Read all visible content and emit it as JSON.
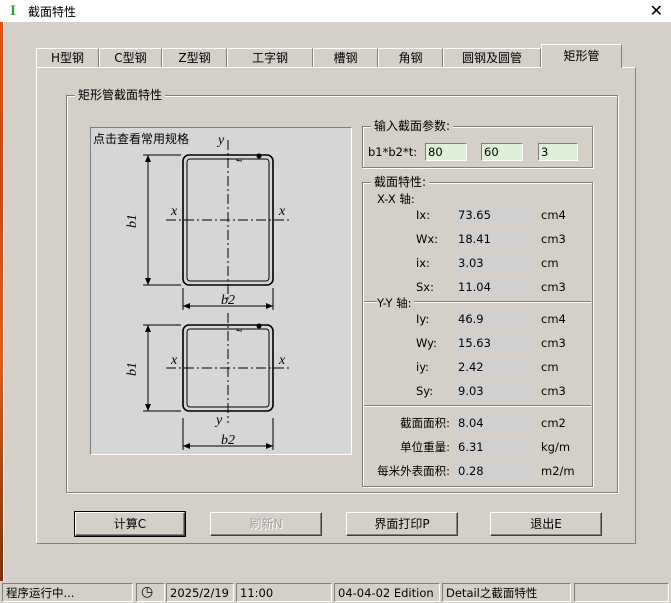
{
  "window": {
    "title": "截面特性",
    "app_icon": "I"
  },
  "tabs": [
    {
      "label": "H型钢"
    },
    {
      "label": "C型钢"
    },
    {
      "label": "Z型钢"
    },
    {
      "label": "工字钢"
    },
    {
      "label": "槽钢"
    },
    {
      "label": "角钢"
    },
    {
      "label": "圆钢及圆管"
    },
    {
      "label": "矩形管"
    }
  ],
  "section_group": {
    "title": "矩形管截面特性"
  },
  "diagram": {
    "label": "点击查看常用规格",
    "axis_y": "y",
    "axis_x": "x",
    "dim_b1": "b1",
    "dim_b2": "b2",
    "dim_t": "t"
  },
  "input_group": {
    "title": "输入截面参数:",
    "label": "b1*b2*t:",
    "b1": "80",
    "b2": "60",
    "t": "3"
  },
  "props_group": {
    "title": "截面特性:"
  },
  "xx": {
    "title": "X-X 轴:",
    "rows": [
      {
        "label": "Ix:",
        "value": "73.65",
        "unit": "cm4"
      },
      {
        "label": "Wx:",
        "value": "18.41",
        "unit": "cm3"
      },
      {
        "label": "ix:",
        "value": "3.03",
        "unit": "cm"
      },
      {
        "label": "Sx:",
        "value": "11.04",
        "unit": "cm3"
      }
    ]
  },
  "yy": {
    "title": "Y-Y 轴:",
    "rows": [
      {
        "label": "Iy:",
        "value": "46.9",
        "unit": "cm4"
      },
      {
        "label": "Wy:",
        "value": "15.63",
        "unit": "cm3"
      },
      {
        "label": "iy:",
        "value": "2.42",
        "unit": "cm"
      },
      {
        "label": "Sy:",
        "value": "9.03",
        "unit": "cm3"
      }
    ]
  },
  "general": {
    "rows": [
      {
        "label": "截面面积:",
        "value": "8.04",
        "unit": "cm2"
      },
      {
        "label": "单位重量:",
        "value": "6.31",
        "unit": "kg/m"
      },
      {
        "label": "每米外表面积:",
        "value": "0.28",
        "unit": "m2/m"
      }
    ]
  },
  "buttons": {
    "calc": "计算C",
    "refresh": "刷新N",
    "print": "界面打印P",
    "exit": "退出E"
  },
  "status": {
    "state": "程序运行中...",
    "date": "2025/2/19",
    "time": "11:00",
    "edition": "04-04-02 Edition",
    "detail": "Detail之截面特性"
  },
  "colors": {
    "input_bg": "#dff0d8",
    "window_bg": "#d4d0c8",
    "accent_icon": "#2fa32f"
  }
}
